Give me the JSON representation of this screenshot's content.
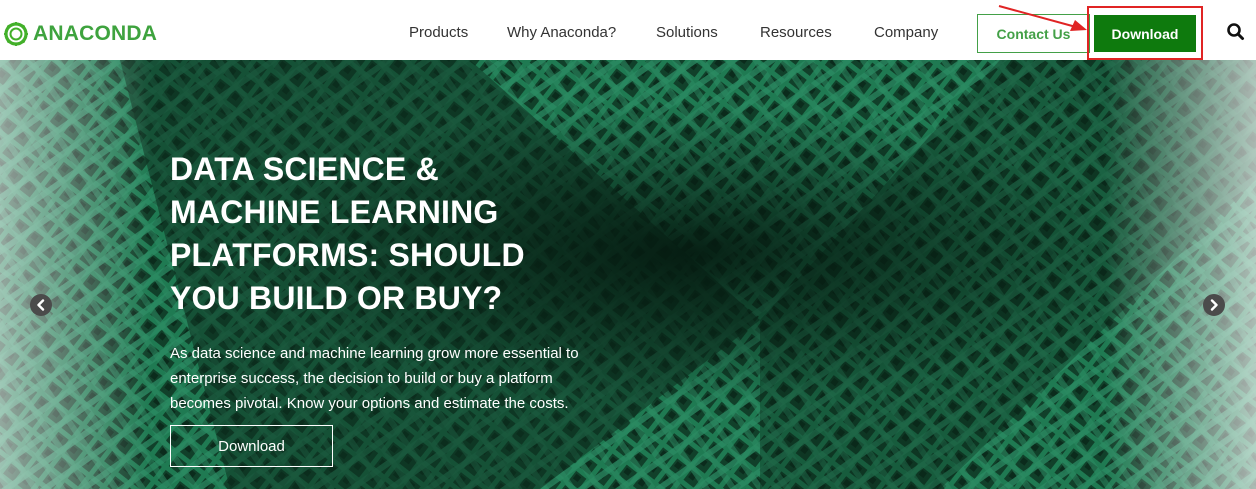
{
  "brand": {
    "name": "ANACONDA",
    "color": "#43b02a"
  },
  "nav": {
    "items": [
      {
        "label": "Products"
      },
      {
        "label": "Why Anaconda?"
      },
      {
        "label": "Solutions"
      },
      {
        "label": "Resources"
      },
      {
        "label": "Company"
      }
    ],
    "contact_label": "Contact Us",
    "download_label": "Download",
    "search_icon": "search-icon"
  },
  "hero": {
    "title_lines": [
      "DATA SCIENCE &",
      "MACHINE LEARNING",
      "PLATFORMS: SHOULD",
      "YOU BUILD OR BUY?"
    ],
    "body": "As data science and machine learning grow more essential to enterprise success, the decision to build or buy a platform becomes pivotal. Know your options and estimate the costs.",
    "cta_label": "Download",
    "prev_icon": "chevron-left-icon",
    "next_icon": "chevron-right-icon"
  },
  "colors": {
    "accent_green": "#0e7a0d",
    "outline_green": "#43a047",
    "annotation_red": "#e02424"
  }
}
